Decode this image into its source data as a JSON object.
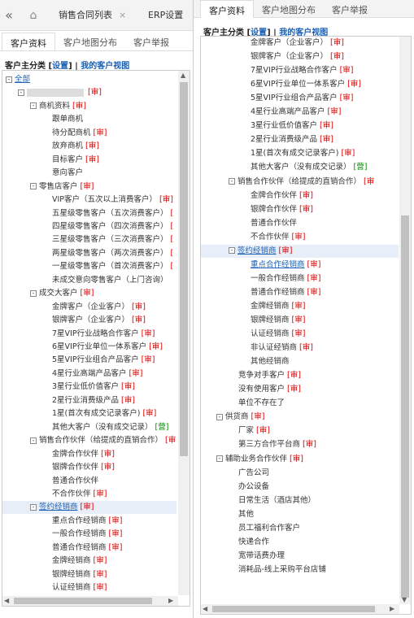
{
  "top_tabs": {
    "collapse": "«",
    "home_icon": "home-icon",
    "tab1": "销售合同列表",
    "tab1_close": "×",
    "tab2": "ERP设置"
  },
  "left": {
    "subtabs": [
      "客户资料",
      "客户地图分布",
      "客户举报"
    ],
    "header": {
      "prefix": "客户主分类 [",
      "settings": "设置",
      "mid": "] | ",
      "my_view": "我的客户视图"
    },
    "rows": [
      {
        "t": "全部",
        "lvl": 0,
        "tog": "-",
        "cls": "link"
      },
      {
        "t": "",
        "lvl": 1,
        "tog": "-",
        "blur": true,
        "tag": "[审]"
      },
      {
        "t": "商机资料",
        "lvl": 2,
        "tog": "-",
        "tag": "[审]"
      },
      {
        "t": "跟单商机",
        "lvl": 3
      },
      {
        "t": "待分配商机",
        "lvl": 3,
        "tag": "[审]"
      },
      {
        "t": "放弃商机",
        "lvl": 3,
        "tag": "[审]"
      },
      {
        "t": "目标客户",
        "lvl": 3,
        "tag": "[审]"
      },
      {
        "t": "意向客户",
        "lvl": 3
      },
      {
        "t": "零售店客户",
        "lvl": 2,
        "tog": "-",
        "tag": "[审]"
      },
      {
        "t": "VIP客户（五次以上消费客户）",
        "lvl": 3,
        "tag": "[审]"
      },
      {
        "t": "五星级零售客户（五次消费客户）",
        "lvl": 3,
        "tag": "["
      },
      {
        "t": "四星级零售客户（四次消费客户）",
        "lvl": 3,
        "tag": "["
      },
      {
        "t": "三星级零售客户（三次消费客户）",
        "lvl": 3,
        "tag": "["
      },
      {
        "t": "两星级零售客户（两次消费客户）",
        "lvl": 3,
        "tag": "["
      },
      {
        "t": "一星级零售客户（首次消费客户）",
        "lvl": 3,
        "tag": "["
      },
      {
        "t": "未成交意向零售客户（上门咨询）",
        "lvl": 3
      },
      {
        "t": "成交大客户",
        "lvl": 2,
        "tog": "-",
        "tag": "[审]"
      },
      {
        "t": "金牌客户（企业客户）",
        "lvl": 3,
        "tag": "[审]"
      },
      {
        "t": "银牌客户（企业客户）",
        "lvl": 3,
        "tag": "[审]"
      },
      {
        "t": "7星VIP行业战略合作客户",
        "lvl": 3,
        "tag": "[审]"
      },
      {
        "t": "6星VIP行业单位一体系客户",
        "lvl": 3,
        "tag": "[审]"
      },
      {
        "t": "5星VIP行业组合产品客户",
        "lvl": 3,
        "tag": "[审]"
      },
      {
        "t": "4星行业高端产品客户",
        "lvl": 3,
        "tag": "[审]"
      },
      {
        "t": "3星行业低价值客户",
        "lvl": 3,
        "tag": "[审]"
      },
      {
        "t": "2星行业消费级产品",
        "lvl": 3,
        "tag": "[审]"
      },
      {
        "t": "1星(首次有成交记录客户)",
        "lvl": 3,
        "tag": "[审]"
      },
      {
        "t": "其他大客户（没有成交记录）",
        "lvl": 3,
        "tag": "[营]",
        "tagcls": "green"
      },
      {
        "t": "销售合作伙伴（给提成的直销合作）",
        "lvl": 2,
        "tog": "-",
        "tag": "[审"
      },
      {
        "t": "金牌合作伙伴",
        "lvl": 3,
        "tag": "[审]"
      },
      {
        "t": "银牌合作伙伴",
        "lvl": 3,
        "tag": "[审]"
      },
      {
        "t": "普通合作伙伴",
        "lvl": 3
      },
      {
        "t": "不合作伙伴",
        "lvl": 3,
        "tag": "[审]"
      },
      {
        "t": "签约经销商",
        "lvl": 2,
        "tog": "-",
        "tag": "[审]",
        "sel": true,
        "cls": "link"
      },
      {
        "t": "重点合作经销商",
        "lvl": 3,
        "tag": "[审]"
      },
      {
        "t": "一般合作经销商",
        "lvl": 3,
        "tag": "[审]"
      },
      {
        "t": "普通合作经销商",
        "lvl": 3,
        "tag": "[审]"
      },
      {
        "t": "金牌经销商",
        "lvl": 3,
        "tag": "[审]"
      },
      {
        "t": "银牌经销商",
        "lvl": 3,
        "tag": "[审]"
      },
      {
        "t": "认证经销商",
        "lvl": 3,
        "tag": "[审]"
      }
    ]
  },
  "right": {
    "subtabs": [
      "客户资料",
      "客户地图分布",
      "客户举报"
    ],
    "header": {
      "prefix": "客户主分类 [",
      "settings": "设置",
      "mid": "] | ",
      "my_view": "我的客户视图"
    },
    "rows": [
      {
        "t": "金牌客户（企业客户）",
        "lvl": 3,
        "tag": "[审]"
      },
      {
        "t": "银牌客户（企业客户）",
        "lvl": 3,
        "tag": "[审]"
      },
      {
        "t": "7星VIP行业战略合作客户",
        "lvl": 3,
        "tag": "[审]"
      },
      {
        "t": "6星VIP行业单位一体系客户",
        "lvl": 3,
        "tag": "[审]"
      },
      {
        "t": "5星VIP行业组合产品客户",
        "lvl": 3,
        "tag": "[审]"
      },
      {
        "t": "4星行业高端产品客户",
        "lvl": 3,
        "tag": "[审]"
      },
      {
        "t": "3星行业低价值客户",
        "lvl": 3,
        "tag": "[审]"
      },
      {
        "t": "2星行业消费级产品",
        "lvl": 3,
        "tag": "[审]"
      },
      {
        "t": "1星(首次有成交记录客户)",
        "lvl": 3,
        "tag": "[审]"
      },
      {
        "t": "其他大客户（没有成交记录）",
        "lvl": 3,
        "tag": "[营]",
        "tagcls": "green"
      },
      {
        "t": "销售合作伙伴（给提成的直销合作）",
        "lvl": 2,
        "tog": "-",
        "tag": "[审"
      },
      {
        "t": "金牌合作伙伴",
        "lvl": 3,
        "tag": "[审]"
      },
      {
        "t": "银牌合作伙伴",
        "lvl": 3,
        "tag": "[审]"
      },
      {
        "t": "普通合作伙伴",
        "lvl": 3
      },
      {
        "t": "不合作伙伴",
        "lvl": 3,
        "tag": "[审]"
      },
      {
        "t": "签约经销商",
        "lvl": 2,
        "tog": "-",
        "tag": "[审]",
        "sel": true,
        "cls": "link"
      },
      {
        "t": "重点合作经销商",
        "lvl": 3,
        "tag": "[审]",
        "cls": "link"
      },
      {
        "t": "一般合作经销商",
        "lvl": 3,
        "tag": "[审]"
      },
      {
        "t": "普通合作经销商",
        "lvl": 3,
        "tag": "[审]"
      },
      {
        "t": "金牌经销商",
        "lvl": 3,
        "tag": "[审]"
      },
      {
        "t": "银牌经销商",
        "lvl": 3,
        "tag": "[审]"
      },
      {
        "t": "认证经销商",
        "lvl": 3,
        "tag": "[审]"
      },
      {
        "t": "非认证经销商",
        "lvl": 3,
        "tag": "[审]"
      },
      {
        "t": "其他经销商",
        "lvl": 3
      },
      {
        "t": "竞争对手客户",
        "lvl": 2,
        "tag": "[审]"
      },
      {
        "t": "没有使用客户",
        "lvl": 2,
        "tag": "[审]"
      },
      {
        "t": "单位不存在了",
        "lvl": 2
      },
      {
        "t": "供货商",
        "lvl": 1,
        "tog": "-",
        "tag": "[审]"
      },
      {
        "t": "厂家",
        "lvl": 2,
        "tag": "[审]"
      },
      {
        "t": "第三方合作平台商",
        "lvl": 2,
        "tag": "[审]"
      },
      {
        "t": "辅助业务合作伙伴",
        "lvl": 1,
        "tog": "-",
        "tag": "[审]"
      },
      {
        "t": "广告公司",
        "lvl": 2
      },
      {
        "t": "办公设备",
        "lvl": 2
      },
      {
        "t": "日常生活（酒店其他）",
        "lvl": 2
      },
      {
        "t": "其他",
        "lvl": 2
      },
      {
        "t": "员工福利合作客户",
        "lvl": 2
      },
      {
        "t": "快递合作",
        "lvl": 2
      },
      {
        "t": "宽带话费办理",
        "lvl": 2
      },
      {
        "t": "消耗品-线上采购平台店铺",
        "lvl": 2
      }
    ]
  }
}
